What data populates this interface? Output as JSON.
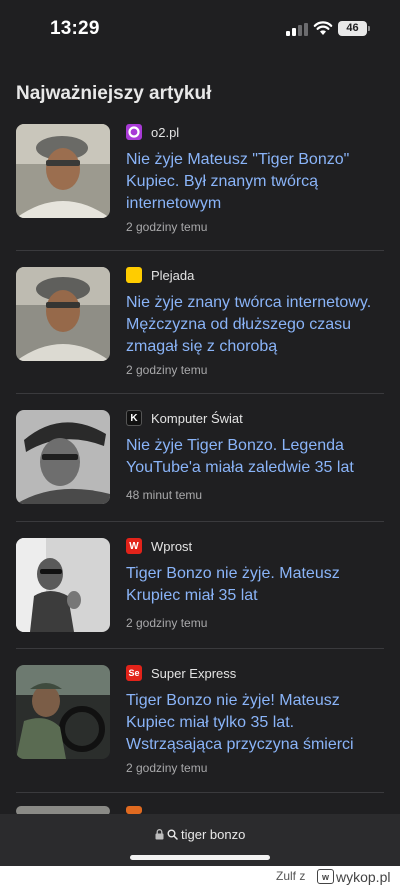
{
  "status_bar": {
    "time": "13:29",
    "battery": "46"
  },
  "section_title": "Najważniejszy artykuł",
  "articles": [
    {
      "source": "o2.pl",
      "source_icon": "o2-logo-icon",
      "source_color": "#a83ad6",
      "source_glyph": "",
      "headline": "Nie żyje Mateusz \"Tiger Bonzo\" Kupiec. Był znanym twórcą internetowym",
      "ago": "2 godziny temu",
      "thumb": "portrait-photo-color"
    },
    {
      "source": "Plejada",
      "source_icon": "plejada-logo-icon",
      "source_color": "#ffcc00",
      "source_glyph": "",
      "headline": "Nie żyje znany twórca internetowy. Mężczyzna od dłuższego czasu zmagał się z chorobą",
      "ago": "2 godziny temu",
      "thumb": "portrait-photo-color"
    },
    {
      "source": "Komputer Świat",
      "source_icon": "komputer-swiat-logo-icon",
      "source_color": "#111111",
      "source_glyph": "K",
      "headline": "Nie żyje Tiger Bonzo. Legenda YouTube'a miała zaledwie 35 lat",
      "ago": "48 minut temu",
      "thumb": "portrait-photo-bw"
    },
    {
      "source": "Wprost",
      "source_icon": "wprost-logo-icon",
      "source_color": "#e2231a",
      "source_glyph": "W",
      "headline": "Tiger Bonzo nie żyje. Mateusz Krupiec miał 35 lat",
      "ago": "2 godziny temu",
      "thumb": "portrait-photo-bw"
    },
    {
      "source": "Super Express",
      "source_icon": "super-express-logo-icon",
      "source_color": "#e2231a",
      "source_glyph": "Se",
      "headline": "Tiger Bonzo nie żyje! Mateusz Kupiec miał tylko 35 lat. Wstrząsająca przyczyna śmierci",
      "ago": "2 godziny temu",
      "thumb": "car-photo-color"
    }
  ],
  "bottom_bar": {
    "url": "tiger bonzo"
  },
  "watermark": {
    "user": "Zulf z",
    "site": "wykop.pl"
  }
}
